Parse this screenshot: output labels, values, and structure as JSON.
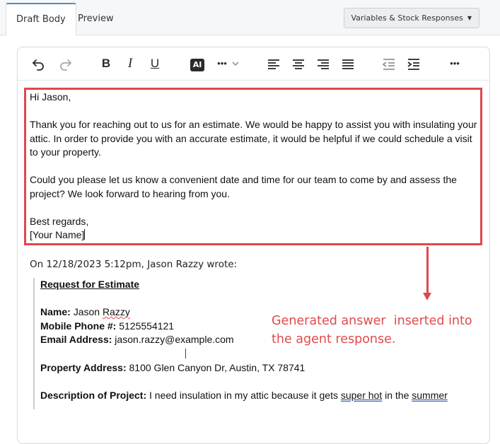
{
  "tabs": {
    "draft_body": "Draft Body",
    "preview": "Preview"
  },
  "toolbar": {
    "variables_button": "Variables & Stock Responses",
    "bold": "B",
    "italic": "I",
    "underline": "U",
    "ai": "AI",
    "more_inline": "•••",
    "more": "•••"
  },
  "generated": {
    "greeting": "Hi Jason,",
    "paragraph1": "Thank you for reaching out to us for an estimate. We would be happy to assist you with insulating your attic. In order to provide you with an accurate estimate, it would be helpful if we could schedule a visit to your property.",
    "paragraph2": "Could you please let us know a convenient date and time for our team to come by and assess the project? We look forward to hearing from you.",
    "closing": "Best regards,",
    "signature": "[Your Name]"
  },
  "quoted": {
    "wrote_line": "On 12/18/2023 5:12pm, Jason Razzy wrote:",
    "title": "Request for Estimate",
    "name_label": "Name:",
    "name_first": "Jason",
    "name_last": "Razzy",
    "phone_label": "Mobile Phone #:",
    "phone_value": "5125554121",
    "email_label": "Email Address:",
    "email_value": "jason.razzy@example.com",
    "address_label": "Property Address:",
    "address_value": "8100 Glen Canyon Dr, Austin, TX 78741",
    "description_label": "Description of Project:",
    "description_start": "I need insulation in my attic because it gets",
    "description_super_hot": "super hot",
    "description_mid": "in the",
    "description_summer": "summer"
  },
  "annotation": {
    "text_line1": "Generated answer  inserted into",
    "text_line2": "the agent response."
  },
  "colors": {
    "highlight_red": "#e0474c",
    "tab_accent": "#4a90c8"
  }
}
